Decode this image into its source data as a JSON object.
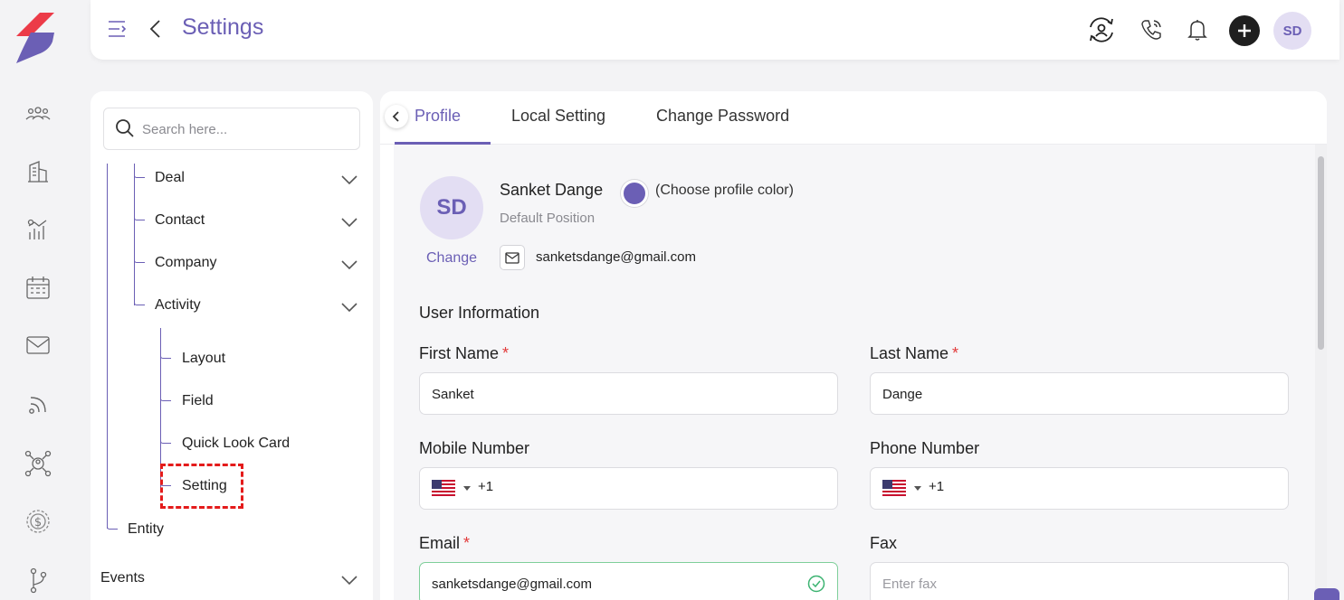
{
  "header": {
    "title": "Settings",
    "user_initials": "SD"
  },
  "sidebar_nav": [
    "people",
    "company",
    "analytics",
    "calendar",
    "mail",
    "feed",
    "network",
    "deals",
    "workflow"
  ],
  "tree": {
    "search_placeholder": "Search here...",
    "items": [
      {
        "label": "Deal",
        "expandable": true
      },
      {
        "label": "Contact",
        "expandable": true
      },
      {
        "label": "Company",
        "expandable": true
      },
      {
        "label": "Activity",
        "expandable": true
      }
    ],
    "activity_children": [
      "Layout",
      "Field",
      "Quick Look Card",
      "Setting"
    ],
    "entity": "Entity",
    "events": "Events"
  },
  "tabs": [
    "Profile",
    "Local Setting",
    "Change Password"
  ],
  "profile": {
    "initials": "SD",
    "change_label": "Change",
    "name": "Sanket Dange",
    "color_label": "(Choose profile color)",
    "profile_color": "#6b5fb5",
    "position": "Default Position",
    "email": "sanketsdange@gmail.com"
  },
  "form": {
    "section_title": "User Information",
    "first_name_label": "First Name",
    "first_name_value": "Sanket",
    "last_name_label": "Last Name",
    "last_name_value": "Dange",
    "mobile_label": "Mobile Number",
    "mobile_code": "+1",
    "phone_label": "Phone Number",
    "phone_code": "+1",
    "email_label": "Email",
    "email_value": "sanketsdange@gmail.com",
    "fax_label": "Fax",
    "fax_placeholder": "Enter fax",
    "required_mark": "*"
  },
  "colors": {
    "accent": "#6b5fb5",
    "highlight": "#e41b1b",
    "valid": "#3cb371"
  }
}
